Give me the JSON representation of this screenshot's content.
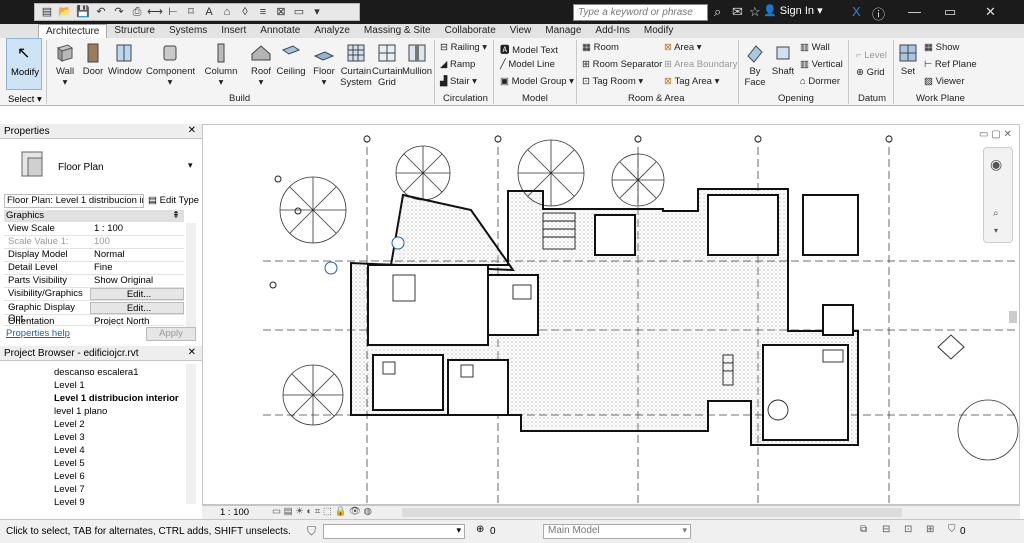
{
  "search": {
    "placeholder": "Type a keyword or phrase"
  },
  "user": {
    "signin": "Sign In"
  },
  "tabs": [
    "Architecture",
    "Structure",
    "Systems",
    "Insert",
    "Annotate",
    "Analyze",
    "Massing & Site",
    "Collaborate",
    "View",
    "Manage",
    "Add-Ins",
    "Modify"
  ],
  "ribbon": {
    "modify": "Modify",
    "select": "Select",
    "build": {
      "label": "Build",
      "wall": "Wall",
      "door": "Door",
      "window": "Window",
      "component": "Component",
      "column": "Column",
      "roof": "Roof",
      "ceiling": "Ceiling",
      "floor": "Floor",
      "curtain_system_1": "Curtain",
      "curtain_system_2": "System",
      "curtain_grid_1": "Curtain",
      "curtain_grid_2": "Grid",
      "mullion": "Mullion"
    },
    "circulation": {
      "label": "Circulation",
      "railing": "Railing",
      "ramp": "Ramp",
      "stair": "Stair"
    },
    "model": {
      "label": "Model",
      "text": "Model Text",
      "line": "Model Line",
      "group": "Model Group"
    },
    "room_area": {
      "label": "Room & Area",
      "room": "Room",
      "separator": "Room Separator",
      "tag_room": "Tag Room",
      "area": "Area",
      "area_boundary": "Area Boundary",
      "tag_area": "Tag Area"
    },
    "opening": {
      "label": "Opening",
      "by_face_1": "By",
      "by_face_2": "Face",
      "shaft": "Shaft",
      "wall": "Wall",
      "vertical": "Vertical",
      "dormer": "Dormer"
    },
    "datum": {
      "label": "Datum",
      "level": "Level",
      "grid": "Grid"
    },
    "work_plane": {
      "label": "Work Plane",
      "set": "Set",
      "show": "Show",
      "ref_plane": "Ref Plane",
      "viewer": "Viewer"
    }
  },
  "properties": {
    "title": "Properties",
    "type_name": "Floor Plan",
    "instance": "Floor Plan: Level 1 distribucion in",
    "edit_type": "Edit Type",
    "section": "Graphics",
    "rows": [
      {
        "k": "View Scale",
        "v": "1 : 100"
      },
      {
        "k": "Scale Value    1:",
        "v": "100"
      },
      {
        "k": "Display Model",
        "v": "Normal"
      },
      {
        "k": "Detail Level",
        "v": "Fine"
      },
      {
        "k": "Parts Visibility",
        "v": "Show Original"
      },
      {
        "k": "Visibility/Graphics ...",
        "v": "Edit..."
      },
      {
        "k": "Graphic Display Opt...",
        "v": "Edit..."
      },
      {
        "k": "Orientation",
        "v": "Project North"
      }
    ],
    "help": "Properties help",
    "apply": "Apply"
  },
  "browser": {
    "title": "Project Browser - edificiojcr.rvt",
    "items": [
      "descanso escalera1",
      "Level 1",
      "Level 1 distribucion interior",
      "level 1 plano",
      "Level 2",
      "Level 3",
      "Level 4",
      "Level 5",
      "Level 6",
      "Level 7",
      "Level 9"
    ]
  },
  "viewbar": {
    "scale": "1 : 100"
  },
  "status": {
    "hint": "Click to select, TAB for alternates, CTRL adds, SHIFT unselects.",
    "zero": "0",
    "model": "Main Model",
    "zero2": "0"
  }
}
